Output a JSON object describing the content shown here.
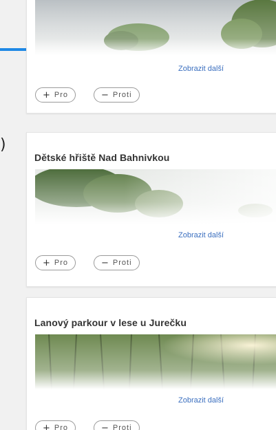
{
  "cards": [
    {
      "title": "",
      "more_label": "Zobrazit další",
      "vote_for_sign": "+",
      "vote_for_label": "Pro",
      "vote_against_sign": "−",
      "vote_against_label": "Proti"
    },
    {
      "title": "Dětské hřiště Nad Bahnivkou",
      "more_label": "Zobrazit další",
      "vote_for_sign": "+",
      "vote_for_label": "Pro",
      "vote_against_sign": "−",
      "vote_against_label": "Proti"
    },
    {
      "title": "Lanový parkour v lese u Jurečku",
      "more_label": "Zobrazit další",
      "vote_for_sign": "+",
      "vote_for_label": "Pro",
      "vote_against_sign": "−",
      "vote_against_label": "Proti"
    }
  ],
  "left_glyph": ")",
  "colors": {
    "accent": "#1e88e5",
    "link": "#3b6fbf",
    "button_border": "#9a9a9a"
  }
}
